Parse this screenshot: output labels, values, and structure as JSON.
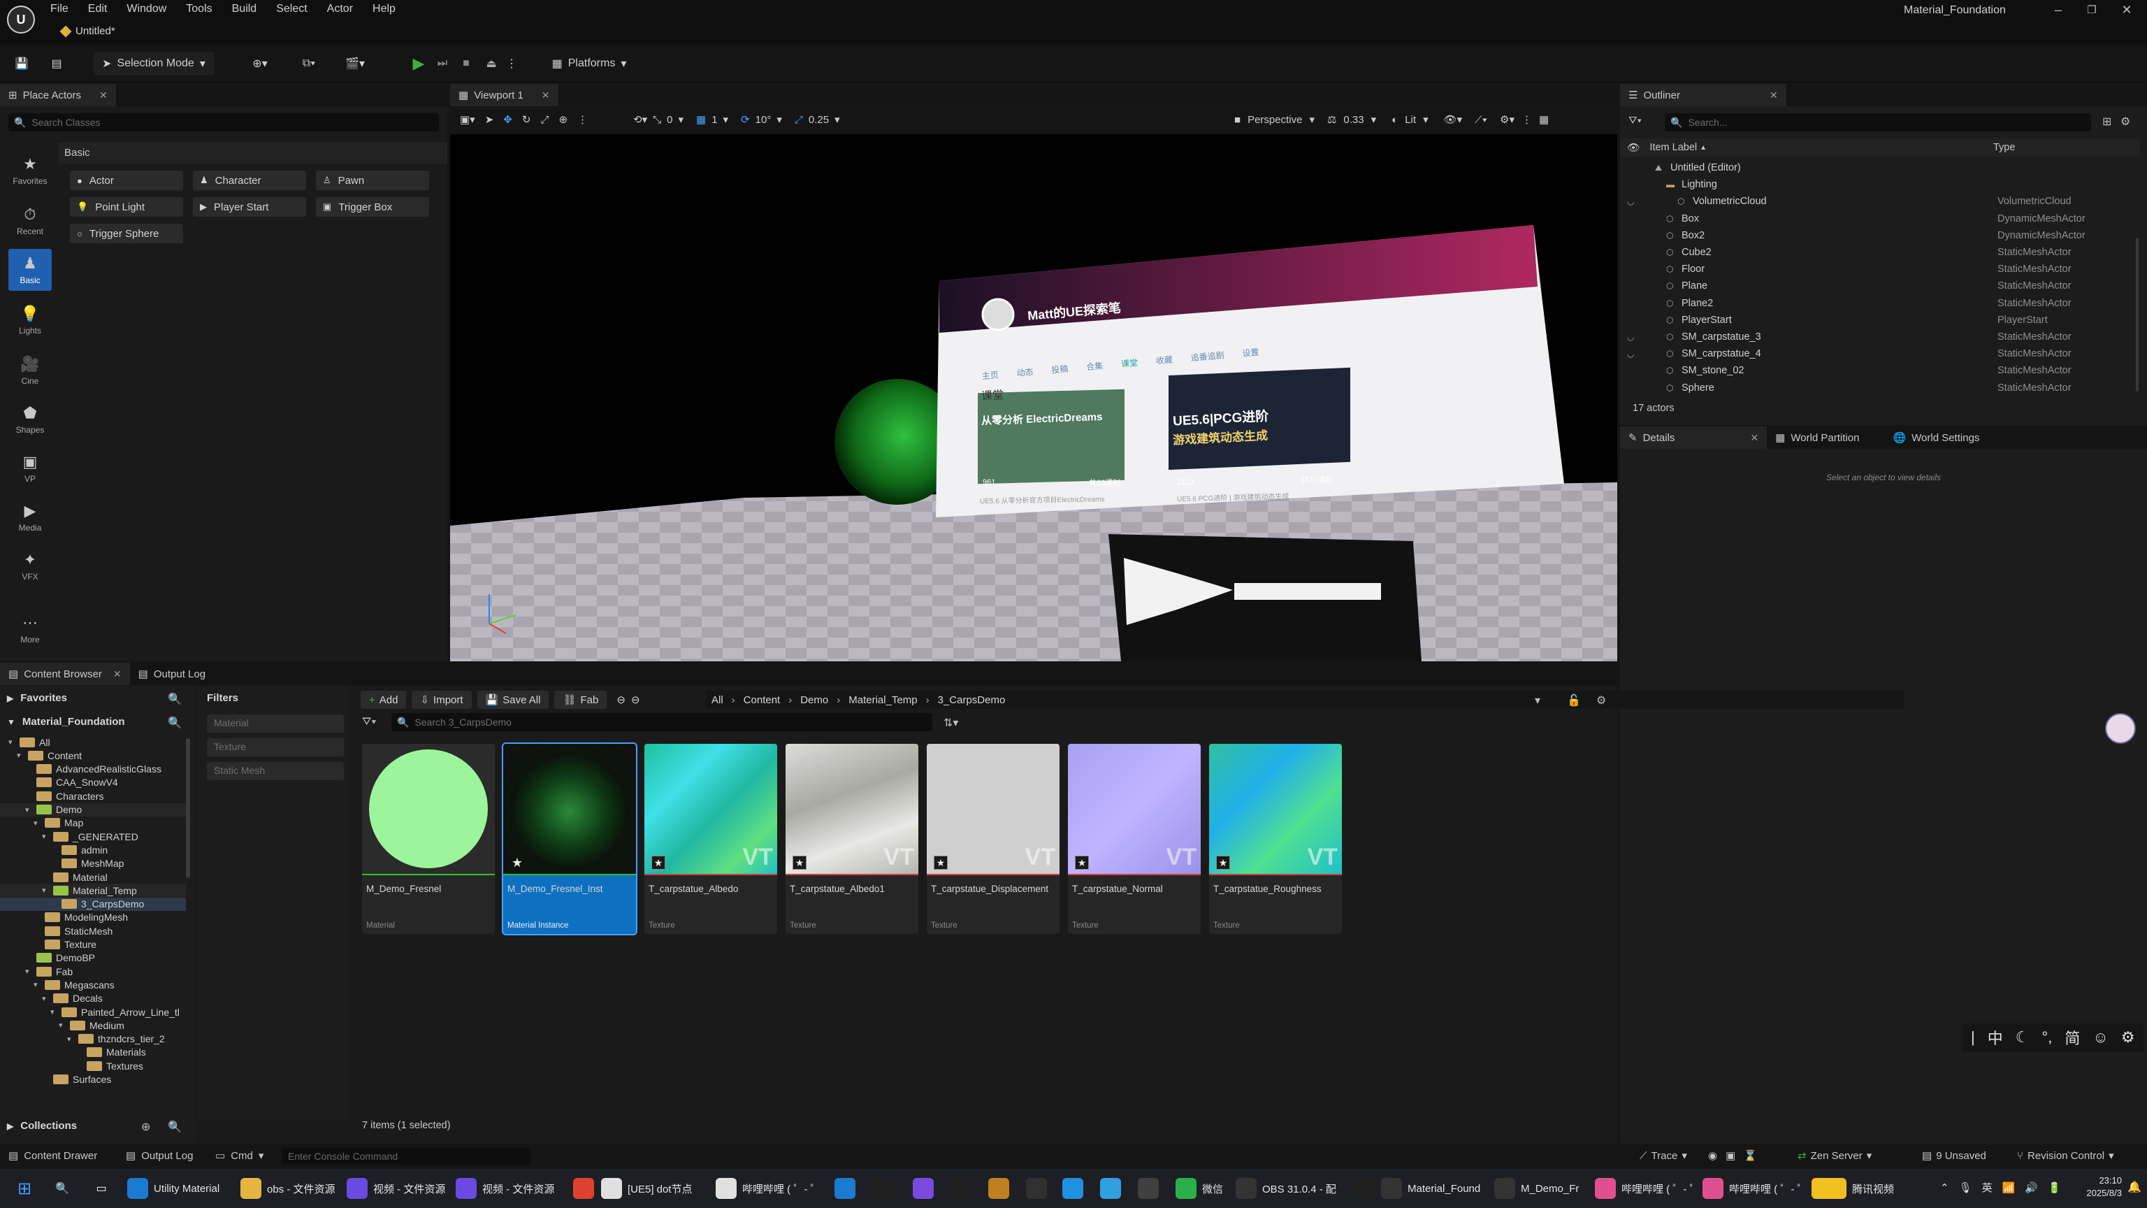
{
  "window": {
    "title": "Material_Foundation",
    "doc_tab": "Untitled*"
  },
  "menu": [
    "File",
    "Edit",
    "Window",
    "Tools",
    "Build",
    "Select",
    "Actor",
    "Help"
  ],
  "toolbar": {
    "selection_mode": "Selection Mode",
    "platforms": "Platforms"
  },
  "place_actors": {
    "tab": "Place Actors",
    "search_placeholder": "Search Classes",
    "section": "Basic",
    "categories": [
      "Favorites",
      "Recent",
      "Basic",
      "Lights",
      "Cine",
      "Shapes",
      "VP",
      "Media",
      "VFX",
      "More"
    ],
    "actors": [
      "Actor",
      "Character",
      "Pawn",
      "Point Light",
      "Player Start",
      "Trigger Box",
      "Trigger Sphere"
    ]
  },
  "viewport": {
    "tab": "Viewport 1",
    "snap_angle": "0",
    "grid": "1",
    "rotation": "10°",
    "scale": "0.25",
    "perspective": "Perspective",
    "fov": "0.33",
    "lit": "Lit",
    "scene": {
      "site_title": "Matt的UE探索笔",
      "nav": [
        "主页",
        "动态",
        "投稿",
        "合集",
        "课堂",
        "收藏",
        "追番追剧",
        "设置"
      ],
      "section": "课堂",
      "card1_title": "ElectricDreams",
      "card1_prefix": "从零分析",
      "card1_count": "共23课时",
      "card1_views": "961",
      "card1_caption": "UE5.6 从零分析官方项目ElectricDreams",
      "card2_title": "UE5.6|PCG进阶",
      "card2_sub": "游戏建筑动态生成",
      "card2_count": "共13课时",
      "card2_views": "2119",
      "card2_caption": "UE5.6 PCG进阶 | 游戏建筑动态生成"
    }
  },
  "outliner": {
    "tab": "Outliner",
    "search_placeholder": "Search...",
    "col_label": "Item Label",
    "col_type": "Type",
    "rows": [
      {
        "label": "Untitled (Editor)",
        "type": "",
        "indent": 1
      },
      {
        "label": "Lighting",
        "type": "",
        "indent": 2
      },
      {
        "label": "VolumetricCloud",
        "type": "VolumetricCloud",
        "indent": 3
      },
      {
        "label": "Box",
        "type": "DynamicMeshActor",
        "indent": 2
      },
      {
        "label": "Box2",
        "type": "DynamicMeshActor",
        "indent": 2
      },
      {
        "label": "Cube2",
        "type": "StaticMeshActor",
        "indent": 2
      },
      {
        "label": "Floor",
        "type": "StaticMeshActor",
        "indent": 2
      },
      {
        "label": "Plane",
        "type": "StaticMeshActor",
        "indent": 2
      },
      {
        "label": "Plane2",
        "type": "StaticMeshActor",
        "indent": 2
      },
      {
        "label": "PlayerStart",
        "type": "PlayerStart",
        "indent": 2
      },
      {
        "label": "SM_carpstatue_3",
        "type": "StaticMeshActor",
        "indent": 2
      },
      {
        "label": "SM_carpstatue_4",
        "type": "StaticMeshActor",
        "indent": 2
      },
      {
        "label": "SM_stone_02",
        "type": "StaticMeshActor",
        "indent": 2
      },
      {
        "label": "Sphere",
        "type": "StaticMeshActor",
        "indent": 2
      }
    ],
    "count": "17 actors"
  },
  "details": {
    "tabs": [
      "Details",
      "World Partition",
      "World Settings"
    ],
    "empty": "Select an object to view details"
  },
  "content_browser": {
    "tabs": [
      "Content Browser",
      "Output Log"
    ],
    "favorites": "Favorites",
    "project": "Material_Foundation",
    "collections": "Collections",
    "filters": "Filters",
    "filter_chips": [
      "Material",
      "Texture",
      "Static Mesh"
    ],
    "add": "Add",
    "import": "Import",
    "save_all": "Save All",
    "fab": "Fab",
    "path": [
      "All",
      "Content",
      "Demo",
      "Material_Temp",
      "3_CarpsDemo"
    ],
    "search_placeholder": "Search 3_CarpsDemo",
    "tree": [
      "All",
      "Content",
      "AdvancedRealisticGlass",
      "CAA_SnowV4",
      "Characters",
      "Demo",
      "Map",
      "_GENERATED",
      "admin",
      "MeshMap",
      "Material",
      "Material_Temp",
      "3_CarpsDemo",
      "ModelingMesh",
      "StaticMesh",
      "Texture",
      "DemoBP",
      "Fab",
      "Megascans",
      "Decals",
      "Painted_Arrow_Line_tl",
      "Medium",
      "thzndcrs_tier_2",
      "Materials",
      "Textures",
      "Surfaces"
    ],
    "assets": [
      {
        "name": "M_Demo_Fresnel",
        "type": "Material"
      },
      {
        "name": "M_Demo_Fresnel_Inst",
        "type": "Material Instance"
      },
      {
        "name": "T_carpstatue_Albedo",
        "type": "Texture"
      },
      {
        "name": "T_carpstatue_Albedo1",
        "type": "Texture"
      },
      {
        "name": "T_carpstatue_Displacement",
        "type": "Texture"
      },
      {
        "name": "T_carpstatue_Normal",
        "type": "Texture"
      },
      {
        "name": "T_carpstatue_Roughness",
        "type": "Texture"
      }
    ],
    "status": "7 items (1 selected)"
  },
  "statusbar": {
    "content_drawer": "Content Drawer",
    "output_log": "Output Log",
    "cmd": "Cmd",
    "console_placeholder": "Enter Console Command",
    "trace": "Trace",
    "zen": "Zen Server",
    "unsaved": "9 Unsaved",
    "revision": "Revision Control"
  },
  "ime": [
    "中",
    "简"
  ],
  "taskbar": {
    "items": [
      "Utility Material",
      "obs - 文件资源",
      "视频 - 文件资源",
      "视频 - 文件资源",
      "[UE5] dot节点",
      "哔哩哔哩 ( ゜- ゜",
      "微信",
      "OBS 31.0.4 - 配",
      "Material_Found",
      "M_Demo_Fr",
      "哔哩哔哩 ( ゜- ゜",
      "哔哩哔哩 ( ゜- ゜",
      "腾讯视频"
    ],
    "lang": "英",
    "time": "23:10",
    "date": "2025/8/3"
  },
  "colors": {
    "accent": "#0e70c0",
    "play": "#3fae3f",
    "folder": "#c8a463",
    "green_folder": "#9ac24a"
  }
}
